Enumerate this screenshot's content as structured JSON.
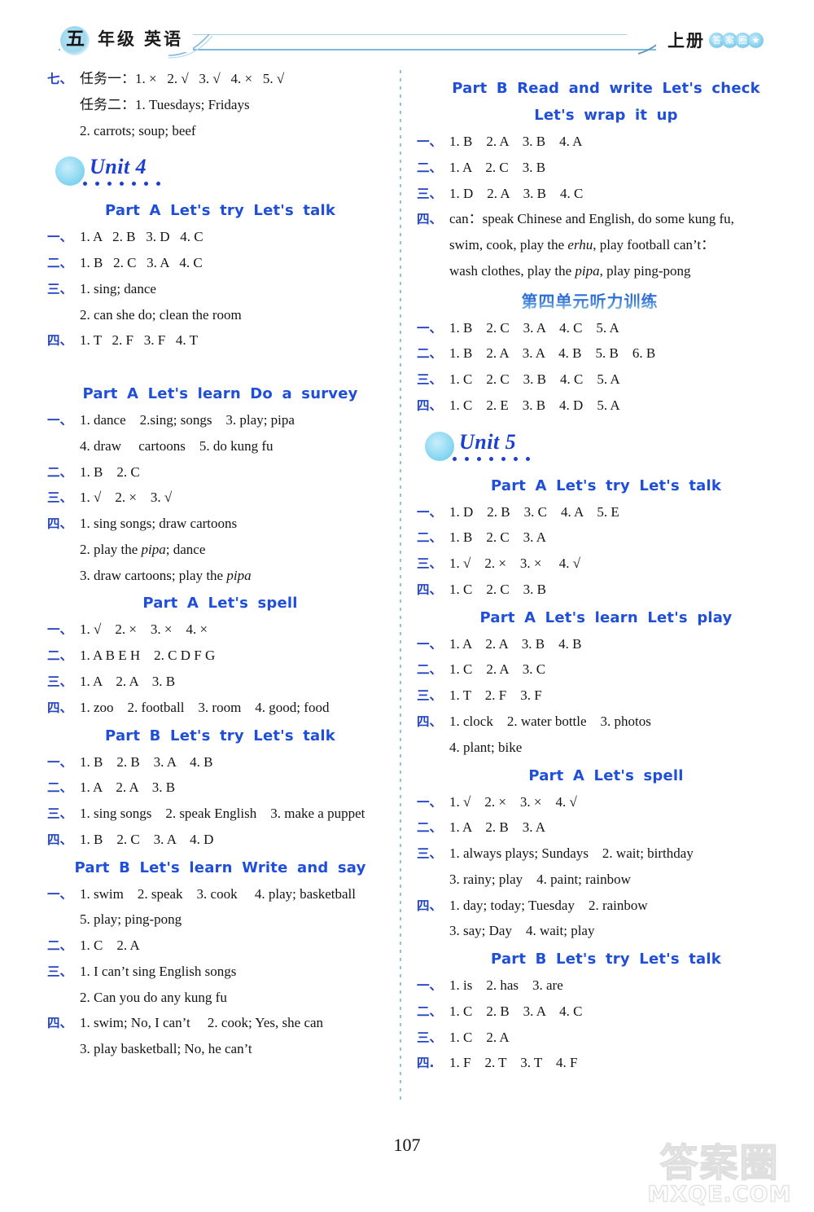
{
  "header": {
    "grade": "五",
    "grade_label": "年级",
    "subject": "英语",
    "volume": "上册",
    "bubbles": "答案圈"
  },
  "left_column": [
    {
      "kind": "answer",
      "num": "七、",
      "text": "任务一：1. ×   2. √   3. √   4. ×   5. √"
    },
    {
      "kind": "cont",
      "text": "任务二：1. Tuesdays; Fridays"
    },
    {
      "kind": "cont",
      "text": "2. carrots; soup; beef"
    },
    {
      "kind": "unit",
      "text": "Unit 4"
    },
    {
      "kind": "part",
      "text": "Part A   Let's try   Let's talk"
    },
    {
      "kind": "answer",
      "num": "一、",
      "text": "1. A   2. B   3. D   4. C"
    },
    {
      "kind": "answer",
      "num": "二、",
      "text": "1. B   2. C   3. A   4. C"
    },
    {
      "kind": "answer",
      "num": "三、",
      "text": "1. sing; dance"
    },
    {
      "kind": "cont",
      "text": "2. can she do; clean the room"
    },
    {
      "kind": "answer",
      "num": "四、",
      "text": "1. T   2. F   3. F   4. T"
    },
    {
      "kind": "gap",
      "size": "md"
    },
    {
      "kind": "part",
      "text": "Part A   Let's learn   Do a survey"
    },
    {
      "kind": "answer",
      "num": "一、",
      "text": "1. dance    2.sing; songs    3. play; pipa"
    },
    {
      "kind": "cont",
      "text": "4. draw     cartoons    5. do kung fu"
    },
    {
      "kind": "answer",
      "num": "二、",
      "text": "1. B    2. C"
    },
    {
      "kind": "answer",
      "num": "三、",
      "text": "1. √    2. ×    3. √"
    },
    {
      "kind": "answer",
      "num": "四、",
      "text": "1. sing songs; draw cartoons"
    },
    {
      "kind": "cont_it",
      "pre": "2. play the ",
      "it": "pipa",
      "post": "; dance"
    },
    {
      "kind": "cont_it",
      "pre": "3. draw cartoons; play the ",
      "it": "pipa",
      "post": ""
    },
    {
      "kind": "part",
      "text": "Part A   Let's spell"
    },
    {
      "kind": "answer",
      "num": "一、",
      "text": "1. √    2. ×    3. ×    4. ×"
    },
    {
      "kind": "answer",
      "num": "二、",
      "text": "1. A B E H    2. C D F G"
    },
    {
      "kind": "answer",
      "num": "三、",
      "text": "1. A    2. A    3. B"
    },
    {
      "kind": "answer",
      "num": "四、",
      "text": "1. zoo    2. football    3. room    4. good; food"
    },
    {
      "kind": "part",
      "text": "Part B   Let's try   Let's talk"
    },
    {
      "kind": "answer",
      "num": "一、",
      "text": "1. B    2. B    3. A    4. B"
    },
    {
      "kind": "answer",
      "num": "二、",
      "text": "1. A    2. A    3. B"
    },
    {
      "kind": "answer",
      "num": "三、",
      "text": "1. sing songs    2. speak English    3. make a puppet"
    },
    {
      "kind": "answer",
      "num": "四、",
      "text": "1. B    2. C    3. A    4. D"
    },
    {
      "kind": "part",
      "text": "Part B   Let's learn   Write and say"
    },
    {
      "kind": "answer",
      "num": "一、",
      "text": "1. swim    2. speak    3. cook     4. play; basketball"
    },
    {
      "kind": "cont",
      "text": "5. play; ping-pong"
    },
    {
      "kind": "answer",
      "num": "二、",
      "text": "1. C    2. A"
    },
    {
      "kind": "answer",
      "num": "三、",
      "text": "1. I can’t sing English songs"
    },
    {
      "kind": "cont",
      "text": "2. Can you do any kung fu"
    },
    {
      "kind": "answer",
      "num": "四、",
      "text": "1. swim; No, I can’t     2. cook; Yes, she can"
    },
    {
      "kind": "cont",
      "text": "3. play basketball; No, he can’t"
    }
  ],
  "right_column": [
    {
      "kind": "part",
      "text": "Part B   Read and write   Let's check"
    },
    {
      "kind": "part",
      "text": "Let's wrap it up"
    },
    {
      "kind": "answer",
      "num": "一、",
      "text": "1. B    2. A    3. B    4. A"
    },
    {
      "kind": "answer",
      "num": "二、",
      "text": "1. A    2. C    3. B"
    },
    {
      "kind": "answer",
      "num": "三、",
      "text": "1. D    2. A    3. B    4. C"
    },
    {
      "kind": "answer",
      "num": "四、",
      "text": "can：speak Chinese and English, do some kung fu,"
    },
    {
      "kind": "cont_it",
      "pre": "swim, cook, play the ",
      "it": "erhu",
      "post": ", play football can’t："
    },
    {
      "kind": "cont_it",
      "pre": "wash clothes, play the ",
      "it": "pipa",
      "post": ", play ping-pong"
    },
    {
      "kind": "cnhead",
      "text": "第四单元听力训练"
    },
    {
      "kind": "answer",
      "num": "一、",
      "text": "1. B    2. C    3. A    4. C    5. A"
    },
    {
      "kind": "answer",
      "num": "二、",
      "text": "1. B    2. A    3. A    4. B    5. B    6. B"
    },
    {
      "kind": "answer",
      "num": "三、",
      "text": "1. C    2. C    3. B    4. C    5. A"
    },
    {
      "kind": "answer",
      "num": "四、",
      "text": "1. C    2. E    3. B    4. D    5. A"
    },
    {
      "kind": "unit",
      "text": "Unit 5"
    },
    {
      "kind": "part",
      "text": "Part A   Let's try   Let's talk"
    },
    {
      "kind": "answer",
      "num": "一、",
      "text": "1. D    2. B    3. C    4. A    5. E"
    },
    {
      "kind": "answer",
      "num": "二、",
      "text": "1. B    2. C    3. A"
    },
    {
      "kind": "answer",
      "num": "三、",
      "text": "1. √    2. ×    3. ×     4. √"
    },
    {
      "kind": "answer",
      "num": "四、",
      "text": "1. C    2. C    3. B"
    },
    {
      "kind": "part",
      "text": "Part A   Let's learn   Let's play"
    },
    {
      "kind": "answer",
      "num": "一、",
      "text": "1. A    2. A    3. B    4. B"
    },
    {
      "kind": "answer",
      "num": "二、",
      "text": "1. C    2. A    3. C"
    },
    {
      "kind": "answer",
      "num": "三、",
      "text": "1. T    2. F    3. F"
    },
    {
      "kind": "answer",
      "num": "四、",
      "text": "1. clock    2. water bottle    3. photos"
    },
    {
      "kind": "cont",
      "text": "4. plant; bike"
    },
    {
      "kind": "part",
      "text": "Part A   Let's spell"
    },
    {
      "kind": "answer",
      "num": "一、",
      "text": "1. √    2. ×    3. ×    4. √"
    },
    {
      "kind": "answer",
      "num": "二、",
      "text": "1. A    2. B    3. A"
    },
    {
      "kind": "answer",
      "num": "三、",
      "text": "1. always plays; Sundays    2. wait; birthday"
    },
    {
      "kind": "cont",
      "text": "3. rainy; play    4. paint; rainbow"
    },
    {
      "kind": "answer",
      "num": "四、",
      "text": "1. day; today; Tuesday    2. rainbow"
    },
    {
      "kind": "cont",
      "text": "3. say; Day    4. wait; play"
    },
    {
      "kind": "part",
      "text": "Part B   Let's try   Let's talk"
    },
    {
      "kind": "answer",
      "num": "一、",
      "text": "1. is    2. has    3. are"
    },
    {
      "kind": "answer",
      "num": "二、",
      "text": "1. C    2. B    3. A    4. C"
    },
    {
      "kind": "answer",
      "num": "三、",
      "text": "1. C    2. A"
    },
    {
      "kind": "answer",
      "num": "四.",
      "text": "1. F    2. T    3. T    4. F"
    }
  ],
  "footer": {
    "page_number": "107"
  },
  "watermark": {
    "cn": "答案圈",
    "en": "MXQE.COM"
  },
  "colors": {
    "heading_blue": "#1f4fd8",
    "number_blue": "#2244c4",
    "circle_cyan": "#8fd9f2",
    "rule_blue": "#7fb8d8"
  }
}
